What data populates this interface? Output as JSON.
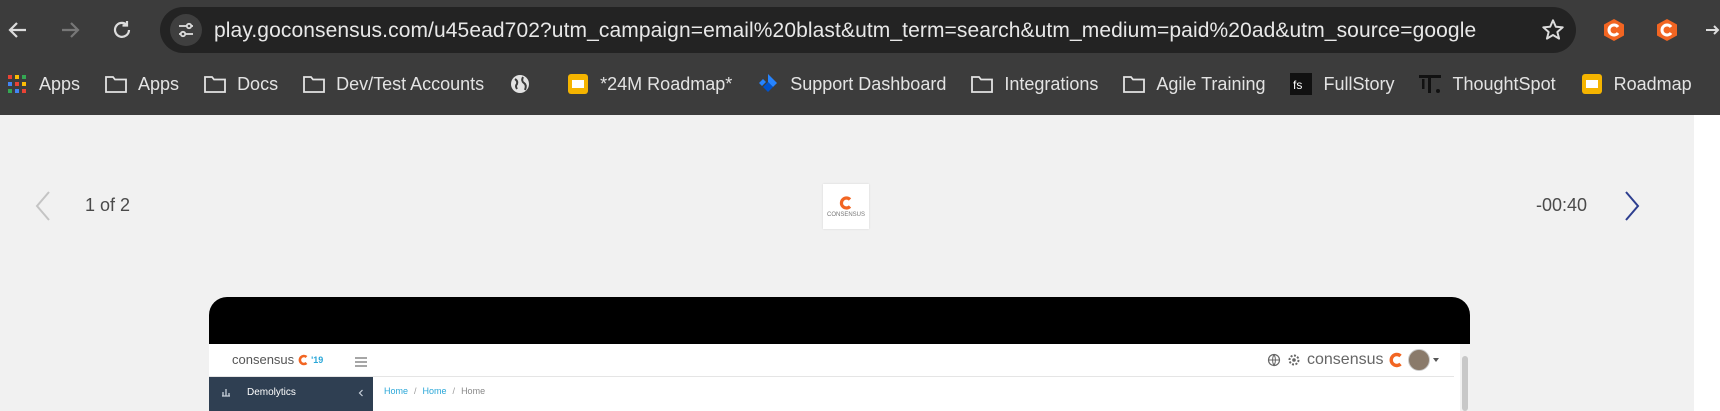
{
  "browser": {
    "url": "play.goconsensus.com/u45ead702?utm_campaign=email%20blast&utm_term=search&utm_medium=paid%20ad&utm_source=google",
    "bookmarks": [
      {
        "label": "Apps",
        "icon": "apps-grid-icon"
      },
      {
        "label": "Apps",
        "icon": "folder-icon"
      },
      {
        "label": "Docs",
        "icon": "folder-icon"
      },
      {
        "label": "Dev/Test Accounts",
        "icon": "folder-icon"
      },
      {
        "label": "",
        "icon": "globe-icon"
      },
      {
        "label": "*24M Roadmap*",
        "icon": "slides-icon"
      },
      {
        "label": "Support Dashboard",
        "icon": "jira-icon"
      },
      {
        "label": "Integrations",
        "icon": "folder-icon"
      },
      {
        "label": "Agile Training",
        "icon": "folder-icon"
      },
      {
        "label": "FullStory",
        "icon": "fullstory-icon"
      },
      {
        "label": "ThoughtSpot",
        "icon": "thoughtspot-icon"
      },
      {
        "label": "Roadmap",
        "icon": "slides-icon"
      }
    ],
    "accent": "#f26522"
  },
  "player": {
    "pager": "1 of 2",
    "timer": "-00:40",
    "logo_text": "CONSENSUS"
  },
  "embedded_app": {
    "brand": "consensus",
    "brand_year": "'19",
    "brand_right": "consensus",
    "sidebar_item": "Demolytics",
    "breadcrumb": [
      "Home",
      "Home",
      "Home"
    ]
  }
}
